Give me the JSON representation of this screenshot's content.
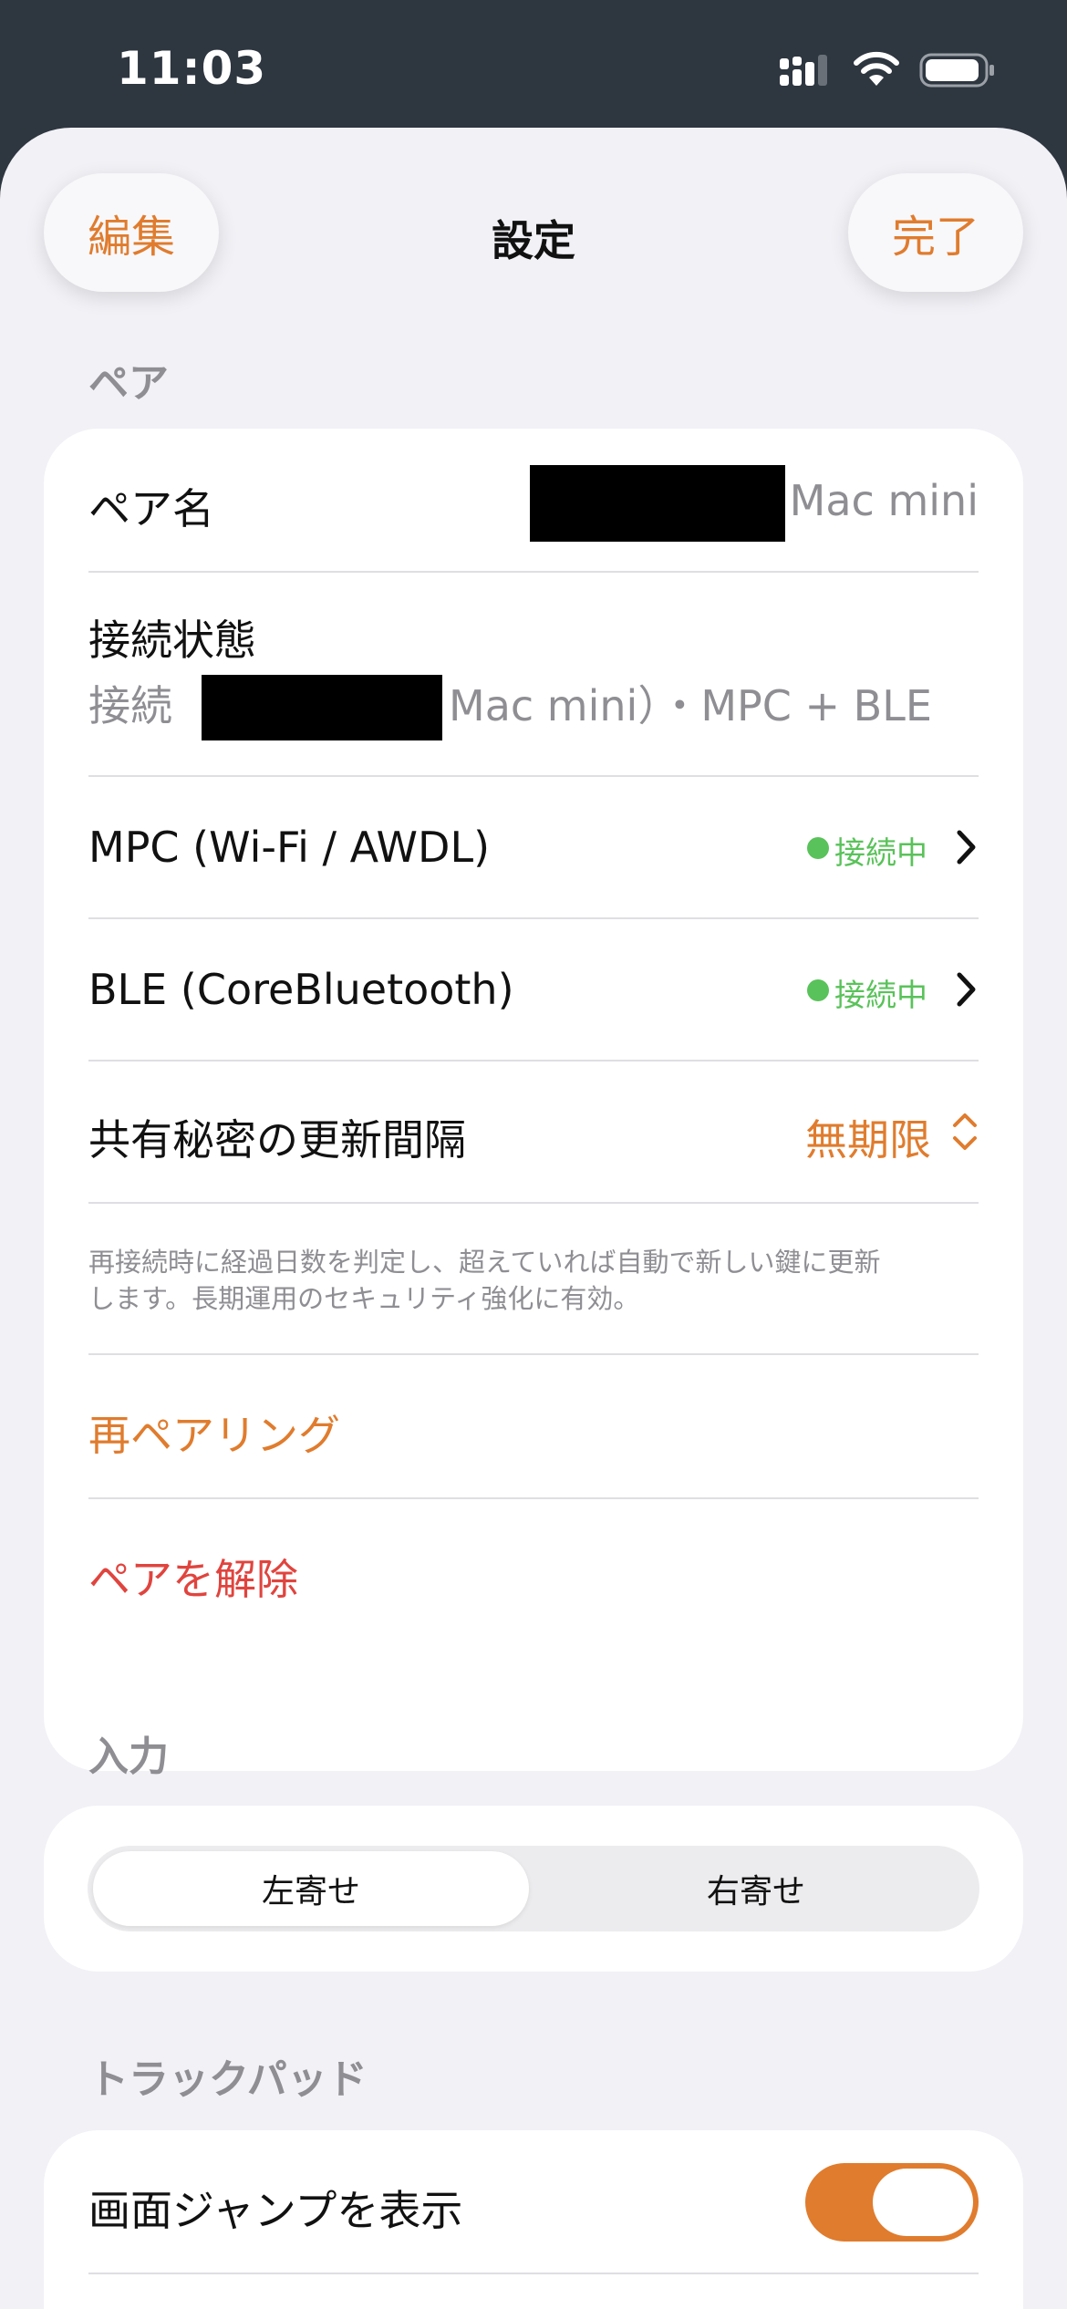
{
  "status_bar": {
    "time": "11:03"
  },
  "nav": {
    "edit_label": "編集",
    "title": "設定",
    "done_label": "完了"
  },
  "pair_section": {
    "header": "ペア",
    "pair_name": {
      "label": "ペア名",
      "value": "Mac mini"
    },
    "connection": {
      "label": "接続状態",
      "prefix": "接続（",
      "suffix": "Mac mini）・MPC + BLE"
    },
    "mpc": {
      "label": "MPC (Wi-Fi / AWDL)",
      "status": "接続中"
    },
    "ble": {
      "label": "BLE (CoreBluetooth)",
      "status": "接続中"
    },
    "secret_interval": {
      "label": "共有秘密の更新間隔",
      "value": "無期限"
    },
    "footnote_line1": "再接続時に経過日数を判定し、超えていれば自動で新しい鍵に更新",
    "footnote_line2": "します。長期運用のセキュリティ強化に有効。",
    "repair_label": "再ペアリング",
    "unpair_label": "ペアを解除"
  },
  "input_section": {
    "header": "入力",
    "options": [
      "左寄せ",
      "右寄せ"
    ],
    "selected": "左寄せ"
  },
  "trackpad_section": {
    "header": "トラックパッド",
    "show_screen_jump": {
      "label": "画面ジャンプを表示",
      "on": true
    }
  },
  "colors": {
    "accent": "#e07c2e",
    "destructive": "#e0443e",
    "connected": "#5ac25a",
    "status_bar_bg": "#2e3640"
  }
}
